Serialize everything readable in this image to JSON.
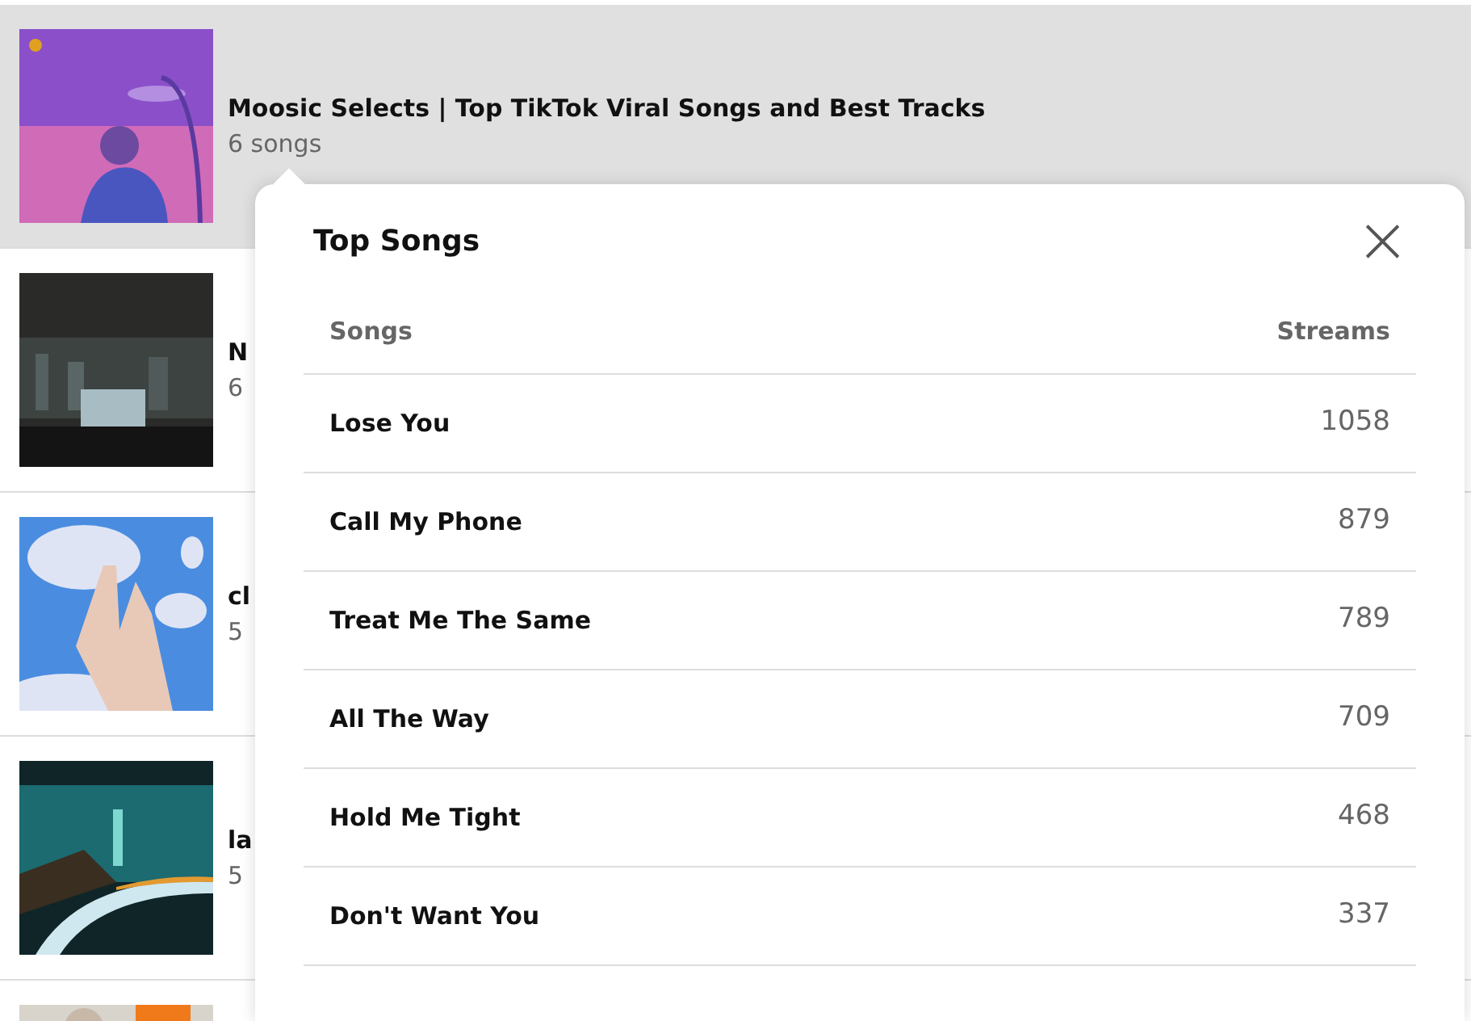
{
  "playlists": [
    {
      "title": "Moosic Selects | Top TikTok Viral Songs and Best Tracks",
      "count": "6 songs",
      "selected": true
    },
    {
      "title": "N",
      "count": "6",
      "selected": false
    },
    {
      "title": "cl",
      "count": "5",
      "selected": false
    },
    {
      "title": "la",
      "count": "5",
      "selected": false
    },
    {
      "selected": false
    }
  ],
  "popover": {
    "title": "Top Songs",
    "close": "×",
    "columns": [
      "Songs",
      "Streams"
    ],
    "rows": [
      {
        "song": "Lose You",
        "streams": "1058"
      },
      {
        "song": "Call My Phone",
        "streams": "879"
      },
      {
        "song": "Treat Me The Same",
        "streams": "789"
      },
      {
        "song": "All The Way",
        "streams": "709"
      },
      {
        "song": "Hold Me Tight",
        "streams": "468"
      },
      {
        "song": "Don't Want You",
        "streams": "337"
      }
    ]
  }
}
